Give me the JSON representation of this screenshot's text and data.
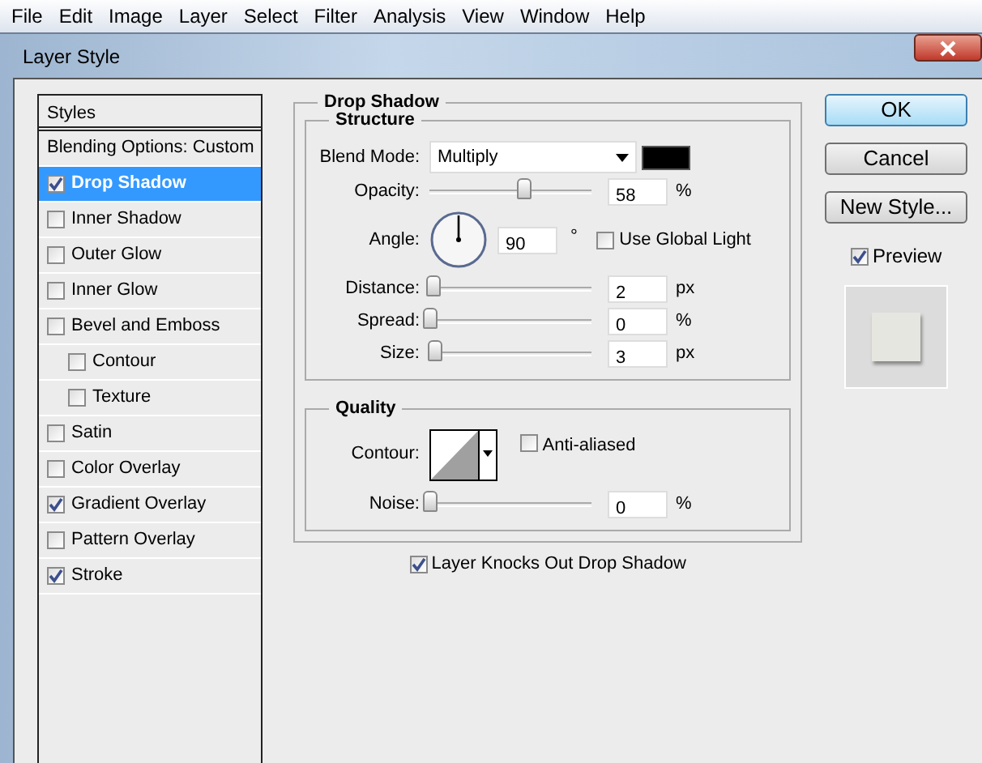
{
  "menu": [
    "File",
    "Edit",
    "Image",
    "Layer",
    "Select",
    "Filter",
    "Analysis",
    "View",
    "Window",
    "Help"
  ],
  "window": {
    "title": "Layer Style"
  },
  "styles_header": "Styles",
  "blending_options": "Blending Options: Custom",
  "effects": [
    {
      "label": "Drop Shadow",
      "checked": true,
      "selected": true
    },
    {
      "label": "Inner Shadow",
      "checked": false,
      "selected": false
    },
    {
      "label": "Outer Glow",
      "checked": false,
      "selected": false
    },
    {
      "label": "Inner Glow",
      "checked": false,
      "selected": false
    },
    {
      "label": "Bevel and Emboss",
      "checked": false,
      "selected": false,
      "children": [
        {
          "label": "Contour",
          "checked": false,
          "selected": false
        },
        {
          "label": "Texture",
          "checked": false,
          "selected": false
        }
      ]
    },
    {
      "label": "Satin",
      "checked": false,
      "selected": false
    },
    {
      "label": "Color Overlay",
      "checked": false,
      "selected": false
    },
    {
      "label": "Gradient Overlay",
      "checked": true,
      "selected": false
    },
    {
      "label": "Pattern Overlay",
      "checked": false,
      "selected": false
    },
    {
      "label": "Stroke",
      "checked": true,
      "selected": false
    }
  ],
  "drop_shadow": {
    "title": "Drop Shadow",
    "structure": {
      "title": "Structure",
      "blend_mode": {
        "label": "Blend Mode:",
        "value": "Multiply",
        "color": "#000000"
      },
      "opacity": {
        "label": "Opacity:",
        "level": 0.58,
        "value": "58",
        "unit": "%"
      },
      "angle": {
        "label": "Angle:",
        "value": "90",
        "unit": "°"
      },
      "use_global_light": {
        "label": "Use Global Light",
        "checked": false
      },
      "sliders": [
        {
          "label": "Distance:",
          "level": 0.02,
          "value": "2",
          "unit": "px"
        },
        {
          "label": "Spread:",
          "level": 0,
          "value": "0",
          "unit": "%"
        },
        {
          "label": "Size:",
          "level": 0.03,
          "value": "3",
          "unit": "px"
        }
      ]
    },
    "quality": {
      "title": "Quality",
      "contour": {
        "label": "Contour:"
      },
      "anti_aliased": {
        "label": "Anti-aliased",
        "checked": false
      },
      "noise": {
        "label": "Noise:",
        "level": 0,
        "value": "0",
        "unit": "%"
      }
    },
    "knockout": {
      "label": "Layer Knocks Out Drop Shadow",
      "checked": true
    }
  },
  "buttons": [
    {
      "label": "OK",
      "default": true
    },
    {
      "label": "Cancel",
      "default": false
    },
    {
      "label": "New Style...",
      "default": false
    }
  ],
  "preview": {
    "label": "Preview",
    "checked": true
  }
}
